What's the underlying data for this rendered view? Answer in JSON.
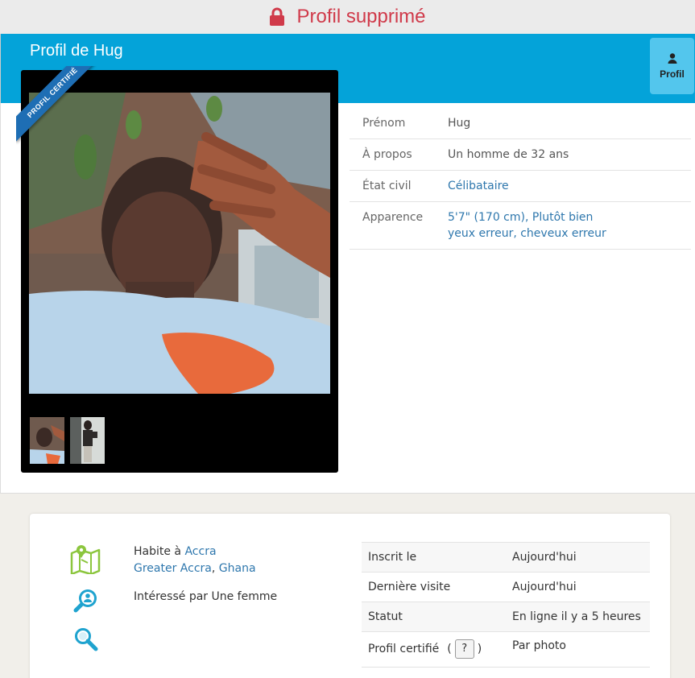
{
  "banner": {
    "text": "Profil supprimé",
    "color": "#d03a4a"
  },
  "header": {
    "title": "Profil de Hug",
    "tab_label": "Profil",
    "accent": "#04a3d9"
  },
  "photo": {
    "ribbon": "PROFIL CERTIFIÉ"
  },
  "details": {
    "rows": [
      {
        "label": "Prénom",
        "value": "Hug"
      },
      {
        "label": "À propos",
        "value": "Un homme de 32 ans"
      },
      {
        "label": "État civil",
        "value": "Célibataire"
      },
      {
        "label": "Apparence",
        "height": "5'7\" (170 cm)",
        "build": "Plutôt bien",
        "eyes": "yeux erreur",
        "hair": "cheveux erreur"
      }
    ]
  },
  "location": {
    "prefix": "Habite à",
    "city": "Accra",
    "region": "Greater Accra",
    "country": "Ghana"
  },
  "interest": {
    "text": "Intéressé par Une femme"
  },
  "stats": {
    "rows": [
      {
        "label": "Inscrit le",
        "value": "Aujourd'hui"
      },
      {
        "label": "Dernière visite",
        "value": "Aujourd'hui"
      },
      {
        "label": "Statut",
        "value": "En ligne il y a 5 heures"
      },
      {
        "label": "Profil certifié",
        "help": "?",
        "value": "Par photo"
      }
    ]
  },
  "icons": [
    "lock-icon",
    "user-icon",
    "map-icon",
    "person-search-icon",
    "search-icon"
  ]
}
